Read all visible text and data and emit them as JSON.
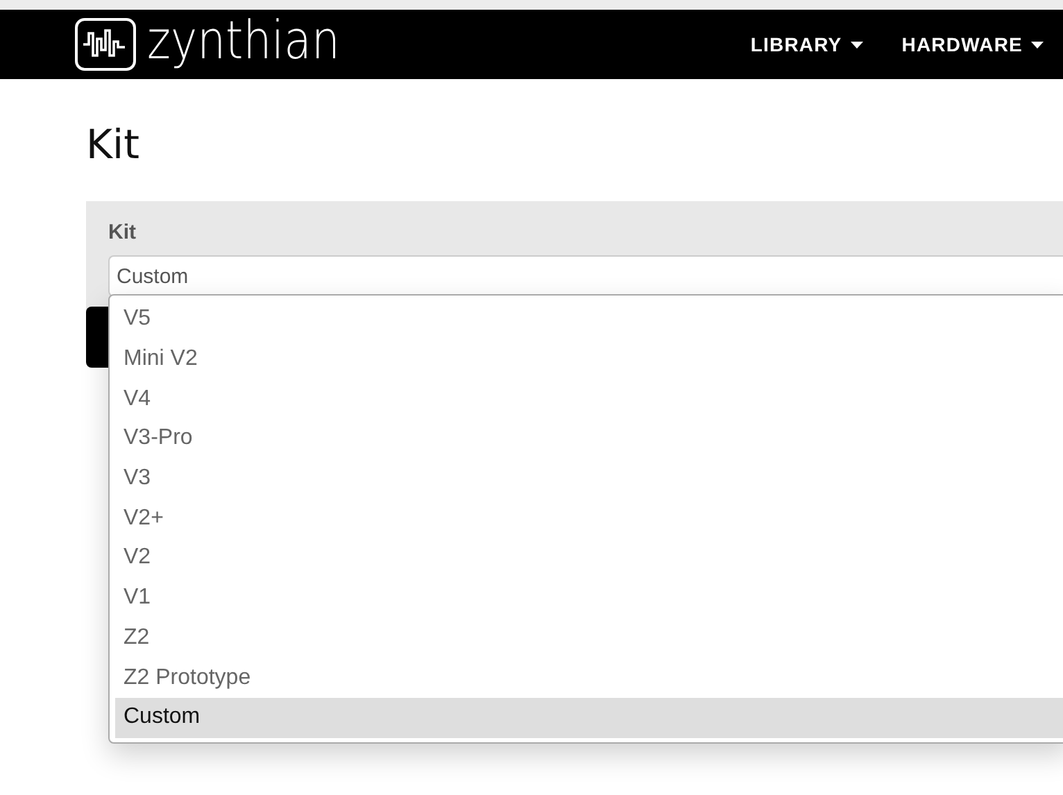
{
  "navbar": {
    "logo_text": "zynthian",
    "menus": [
      {
        "label": "LIBRARY"
      },
      {
        "label": "HARDWARE"
      }
    ]
  },
  "page": {
    "title": "Kit"
  },
  "form": {
    "label": "Kit",
    "select": {
      "value": "Custom",
      "expanded": true,
      "options": [
        {
          "label": "V5",
          "selected": false
        },
        {
          "label": "Mini V2",
          "selected": false
        },
        {
          "label": "V4",
          "selected": false
        },
        {
          "label": "V3-Pro",
          "selected": false
        },
        {
          "label": "V3",
          "selected": false
        },
        {
          "label": "V2+",
          "selected": false
        },
        {
          "label": "V2",
          "selected": false
        },
        {
          "label": "V1",
          "selected": false
        },
        {
          "label": "Z2",
          "selected": false
        },
        {
          "label": "Z2 Prototype",
          "selected": false
        },
        {
          "label": "Custom",
          "selected": true
        }
      ]
    }
  }
}
